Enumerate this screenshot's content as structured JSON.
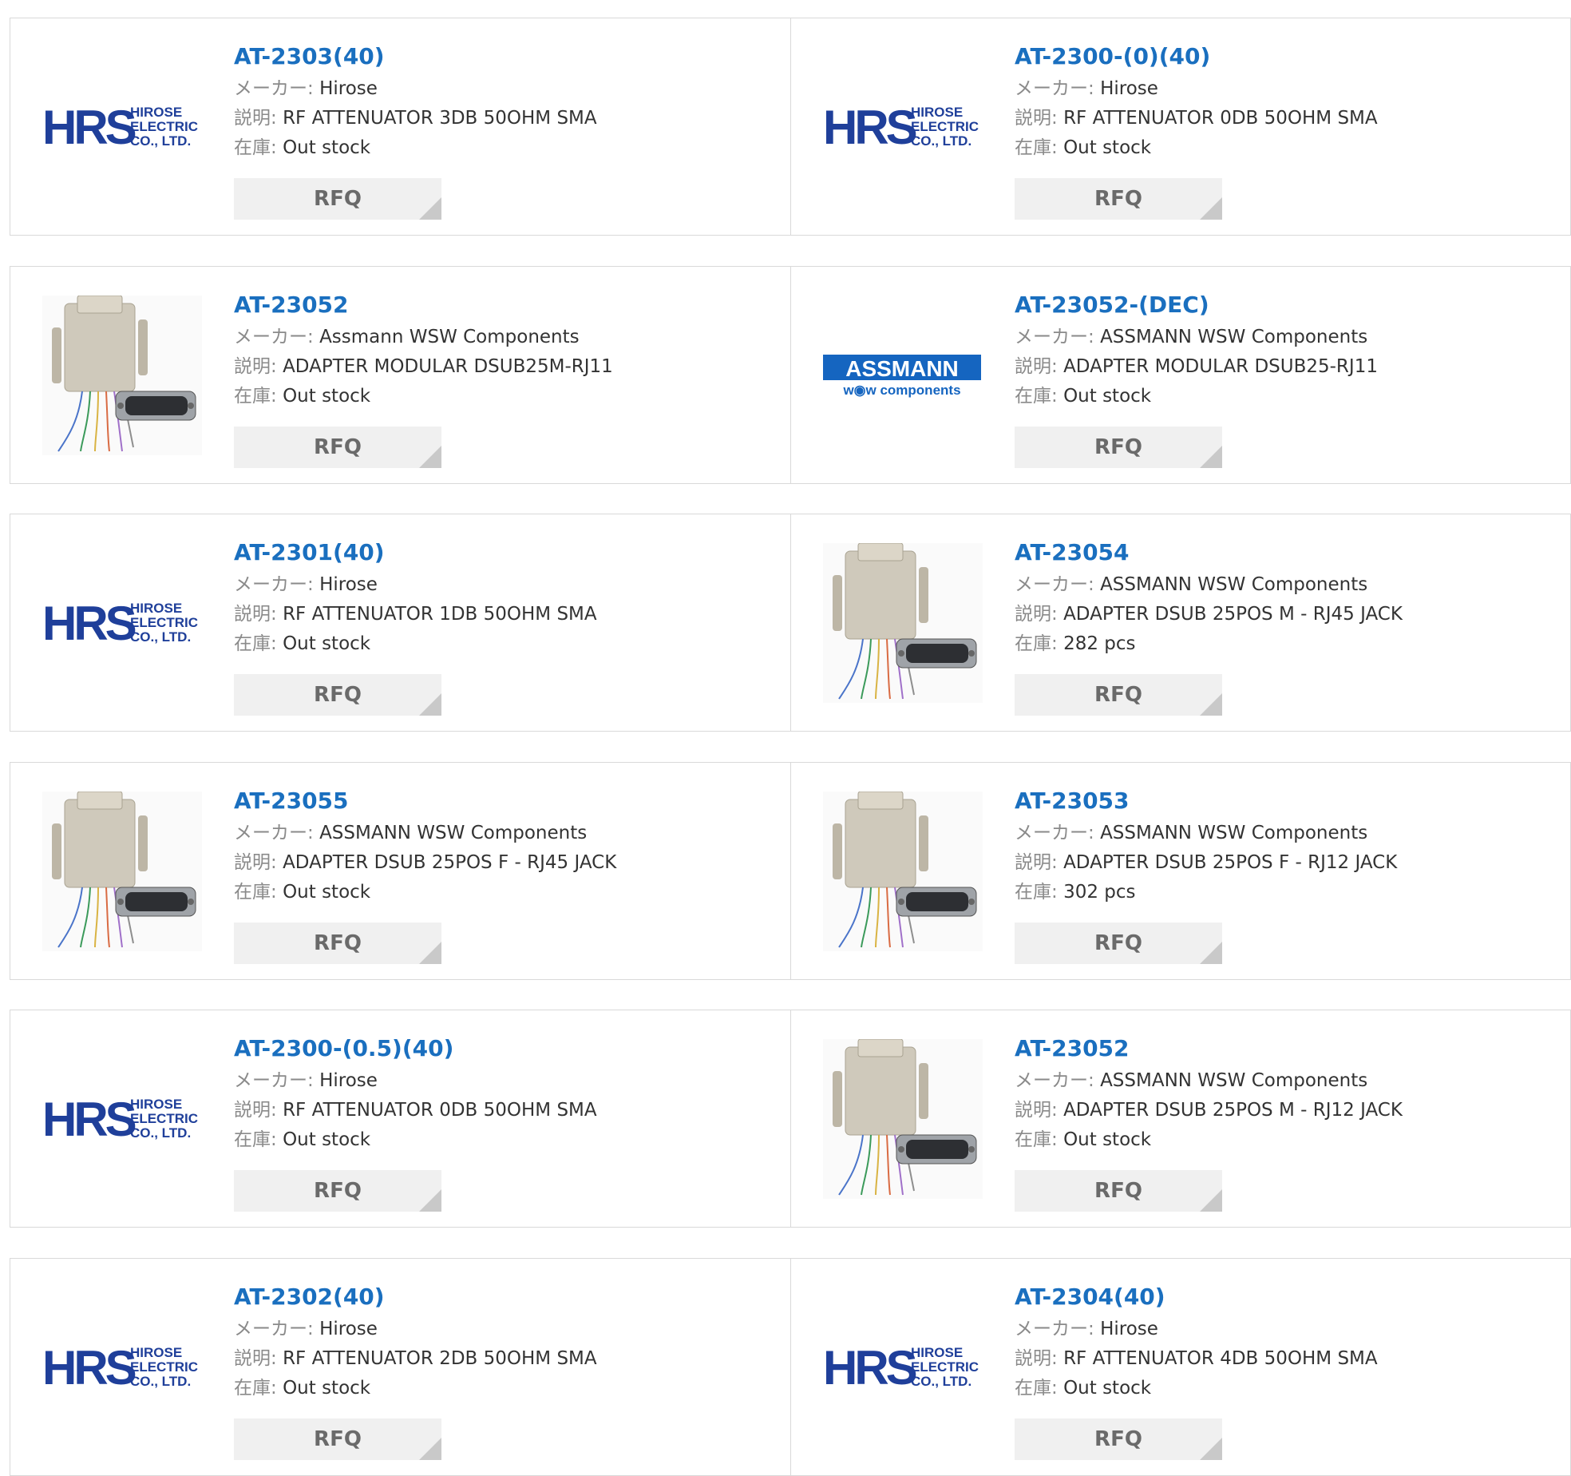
{
  "labels": {
    "maker": "メーカー:",
    "description": "説明:",
    "stock": "在庫:",
    "rfq": "RFQ"
  },
  "logos": {
    "hrs_big": "HRS",
    "hrs_l1": "HIROSE",
    "hrs_l2": "ELECTRIC",
    "hrs_l3": "CO., LTD.",
    "assmann_top": "ASSMANN",
    "assmann_bottom": "w◉w components"
  },
  "colors": {
    "link": "#1a6fbf",
    "hrs_blue": "#1f3f9a",
    "assmann_blue": "#1565c0"
  },
  "products": [
    {
      "part": "AT-2303(40)",
      "maker": "Hirose",
      "desc": "RF ATTENUATOR 3DB 50OHM SMA",
      "stock": "Out stock",
      "image": "hrs-logo"
    },
    {
      "part": "AT-2300-(0)(40)",
      "maker": "Hirose",
      "desc": "RF ATTENUATOR 0DB 50OHM SMA",
      "stock": "Out stock",
      "image": "hrs-logo"
    },
    {
      "part": "AT-23052",
      "maker": "Assmann WSW Components",
      "desc": "ADAPTER MODULAR DSUB25M-RJ11",
      "stock": "Out stock",
      "image": "adapter-photo"
    },
    {
      "part": "AT-23052-(DEC)",
      "maker": "ASSMANN WSW Components",
      "desc": "ADAPTER MODULAR DSUB25-RJ11",
      "stock": "Out stock",
      "image": "assmann-logo"
    },
    {
      "part": "AT-2301(40)",
      "maker": "Hirose",
      "desc": "RF ATTENUATOR 1DB 50OHM SMA",
      "stock": "Out stock",
      "image": "hrs-logo"
    },
    {
      "part": "AT-23054",
      "maker": "ASSMANN WSW Components",
      "desc": "ADAPTER DSUB 25POS M - RJ45 JACK",
      "stock": "282 pcs",
      "image": "adapter-photo"
    },
    {
      "part": "AT-23055",
      "maker": "ASSMANN WSW Components",
      "desc": "ADAPTER DSUB 25POS F - RJ45 JACK",
      "stock": "Out stock",
      "image": "adapter-photo"
    },
    {
      "part": "AT-23053",
      "maker": "ASSMANN WSW Components",
      "desc": "ADAPTER DSUB 25POS F - RJ12 JACK",
      "stock": "302 pcs",
      "image": "adapter-photo"
    },
    {
      "part": "AT-2300-(0.5)(40)",
      "maker": "Hirose",
      "desc": "RF ATTENUATOR 0DB 50OHM SMA",
      "stock": "Out stock",
      "image": "hrs-logo"
    },
    {
      "part": "AT-23052",
      "maker": "ASSMANN WSW Components",
      "desc": "ADAPTER DSUB 25POS M - RJ12 JACK",
      "stock": "Out stock",
      "image": "adapter-photo"
    },
    {
      "part": "AT-2302(40)",
      "maker": "Hirose",
      "desc": "RF ATTENUATOR 2DB 50OHM SMA",
      "stock": "Out stock",
      "image": "hrs-logo"
    },
    {
      "part": "AT-2304(40)",
      "maker": "Hirose",
      "desc": "RF ATTENUATOR 4DB 50OHM SMA",
      "stock": "Out stock",
      "image": "hrs-logo"
    }
  ]
}
